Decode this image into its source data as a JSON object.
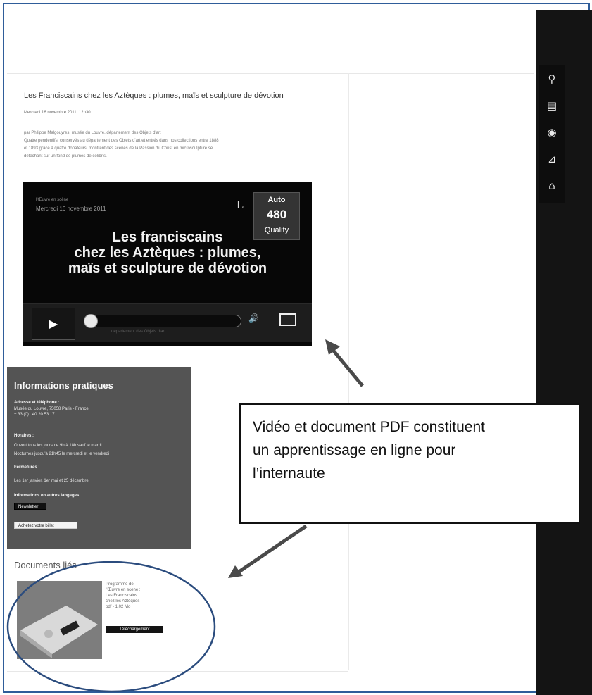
{
  "article": {
    "title": "Les Franciscains chez les Aztèques : plumes, maïs et sculpture de dévotion",
    "date": "Mercredi 16 novembre 2011, 12h30",
    "body_lines": [
      "par Philippe Malgouyres, musée du Louvre, département des Objets d'art",
      "Quatre pendentifs, conservés au département des Objets d'art et entrés dans nos collections entre 1888",
      "et 1893 grâce à quatre donateurs, montrent des scènes de la Passion du Christ en microsculpture se",
      "détachant sur un fond de plumes de colibris."
    ]
  },
  "video": {
    "tag_line_1": "l'Œuvre en scène",
    "tag_line_2": "Mercredi 16 novembre 2011",
    "logo": "L",
    "title_line_1": "Les franciscains",
    "title_line_2": "chez les Aztèques : plumes,",
    "title_line_3": "maïs et sculpture de dévotion",
    "quality_auto": "Auto",
    "quality_value": "480",
    "quality_label": "Quality",
    "control_caption": "département des Objets d'art"
  },
  "info": {
    "heading": "Informations pratiques",
    "lines": [
      {
        "text": "Adresse et téléphone :",
        "bold": true
      },
      {
        "text": "Musée du Louvre, 75058 Paris - France",
        "bold": false
      },
      {
        "text": "+ 33 (0)1 40 20 53 17",
        "bold": false
      },
      {
        "text": "Horaires :",
        "bold": true
      },
      {
        "text": "Ouvert tous les jours de 9h à 18h sauf le mardi",
        "bold": false
      },
      {
        "text": "Nocturnes jusqu'à 21h45 le mercredi et le vendredi",
        "bold": false
      },
      {
        "text": "Fermetures :",
        "bold": true
      },
      {
        "text": "Les 1er janvier, 1er mai et 25 décembre",
        "bold": false
      },
      {
        "text": "Informations en autres langages",
        "bold": true
      }
    ],
    "newsletter_label": "Newsletter",
    "ticket_label": "Achetez votre billet"
  },
  "callout": {
    "line_1": "Vidéo et document PDF constituent",
    "line_2": "un apprentissage en ligne pour",
    "line_3": "l’internaute"
  },
  "documents": {
    "heading": "Documents liés",
    "item_title_lines": [
      "Programme de",
      "l'Œuvre en scène :",
      "Les Franciscains",
      "chez les Aztèques",
      "pdf - 1.02 Mo"
    ],
    "download_label": "Téléchargement"
  },
  "icons": [
    "search-icon",
    "document-icon",
    "play-circle-icon",
    "map-icon",
    "bag-icon"
  ],
  "colors": {
    "frame": "#2f5d9a",
    "rail": "#141414",
    "info_panel": "#545454",
    "ellipse": "#2b4c7e",
    "arrow": "#4a4a4a"
  }
}
